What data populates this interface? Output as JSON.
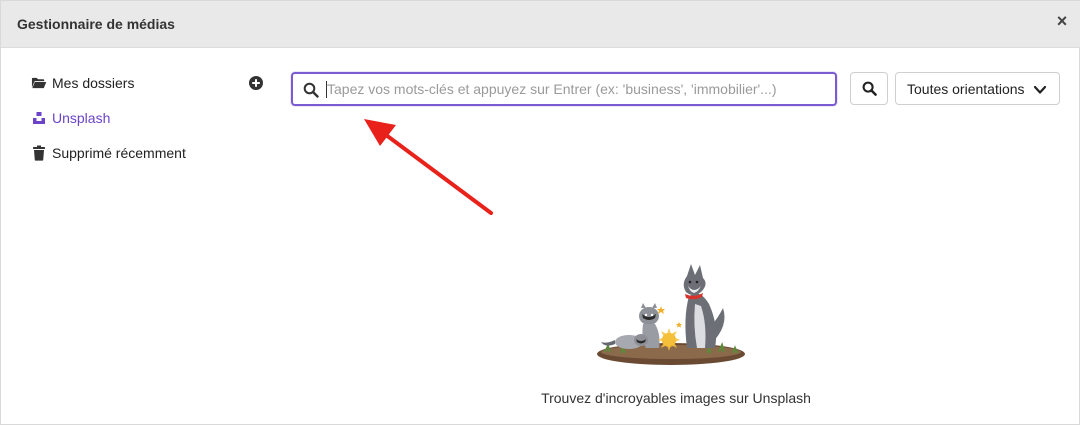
{
  "header": {
    "title": "Gestionnaire de médias",
    "close_glyph": "×"
  },
  "sidebar": {
    "items": [
      {
        "label": "Mes dossiers",
        "icon": "folder-open-icon",
        "active": false
      },
      {
        "label": "Unsplash",
        "icon": "unsplash-icon",
        "active": true
      },
      {
        "label": "Supprimé récemment",
        "icon": "trash-icon",
        "active": false
      }
    ],
    "add_icon": "plus-circle-icon"
  },
  "search": {
    "placeholder": "Tapez vos mots-clés et appuyez sur Entrer (ex: 'business', 'immobilier'...)",
    "value": ""
  },
  "orientation": {
    "selected": "Toutes orientations"
  },
  "empty_state": {
    "message": "Trouvez d'incroyables images sur Unsplash"
  },
  "colors": {
    "accent": "#6b44c9",
    "annotation_arrow": "#e8221b",
    "header_bg": "#e9e9e9"
  }
}
